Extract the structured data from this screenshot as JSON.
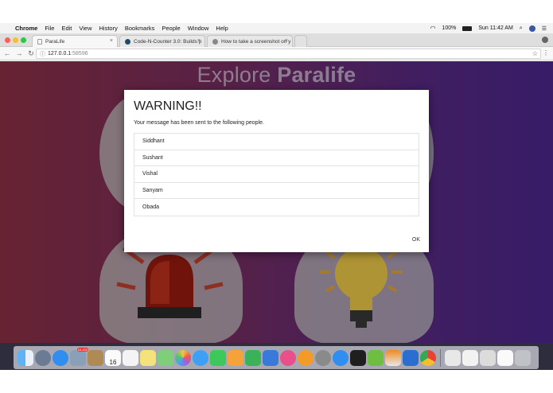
{
  "menubar": {
    "app": "Chrome",
    "items": [
      "File",
      "Edit",
      "View",
      "History",
      "Bookmarks",
      "People",
      "Window",
      "Help"
    ],
    "battery": "100%",
    "clock": "Sun 11:42 AM"
  },
  "tabs": [
    {
      "label": "ParaLife",
      "active": true
    },
    {
      "label": "Code-N-Counter 3.0: Builds p",
      "active": false
    },
    {
      "label": "How to take a screenshot on y",
      "active": false
    }
  ],
  "address": {
    "host": "127.0.0.1",
    "port": ":58596"
  },
  "hero": {
    "light": "Explore ",
    "bold": "Paralife"
  },
  "dialog": {
    "title": "WARNING!!",
    "message": "Your message has been sent to the following people.",
    "people": [
      "Siddhant",
      "Sushant",
      "Vishal",
      "Sanyam",
      "Obada"
    ],
    "ok_label": "OK"
  },
  "dock": {
    "icons": [
      "finder-icon",
      "launchpad-icon",
      "safari-icon",
      "photos-icon",
      "contacts-icon",
      "calendar-icon",
      "reminders-icon",
      "notes-icon",
      "maps-icon",
      "photos-app-icon",
      "messages-icon",
      "facetime-icon",
      "pages-icon",
      "numbers-icon",
      "keynote-icon",
      "itunes-icon",
      "ibooks-icon",
      "system-prefs-icon",
      "app-store-icon",
      "terminal-icon",
      "upwork-icon",
      "vlc-icon",
      "xcode-icon",
      "chrome-icon"
    ],
    "calendar_day": "16",
    "mail_badge": "10,432"
  }
}
